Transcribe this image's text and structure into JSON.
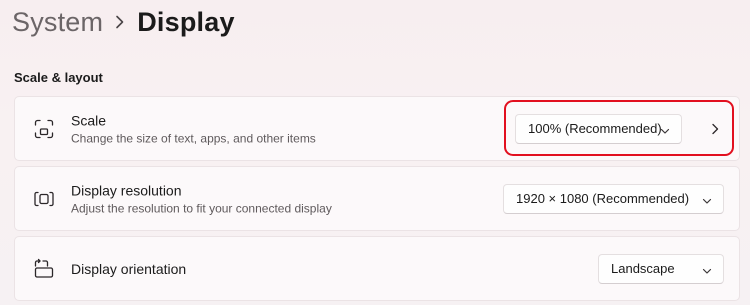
{
  "breadcrumb": {
    "parent": "System",
    "current": "Display"
  },
  "section": {
    "title": "Scale & layout"
  },
  "settings": [
    {
      "icon": "scale-icon",
      "title": "Scale",
      "description": "Change the size of text, apps, and other items",
      "value": "100% (Recommended)",
      "has_expand": true
    },
    {
      "icon": "display-resolution-icon",
      "title": "Display resolution",
      "description": "Adjust the resolution to fit your connected display",
      "value": "1920 × 1080 (Recommended)"
    },
    {
      "icon": "display-orientation-icon",
      "title": "Display orientation",
      "value": "Landscape"
    }
  ],
  "colors": {
    "highlight": "#e2101f",
    "background": "#f7eff1",
    "card": "#fcf9fa"
  }
}
